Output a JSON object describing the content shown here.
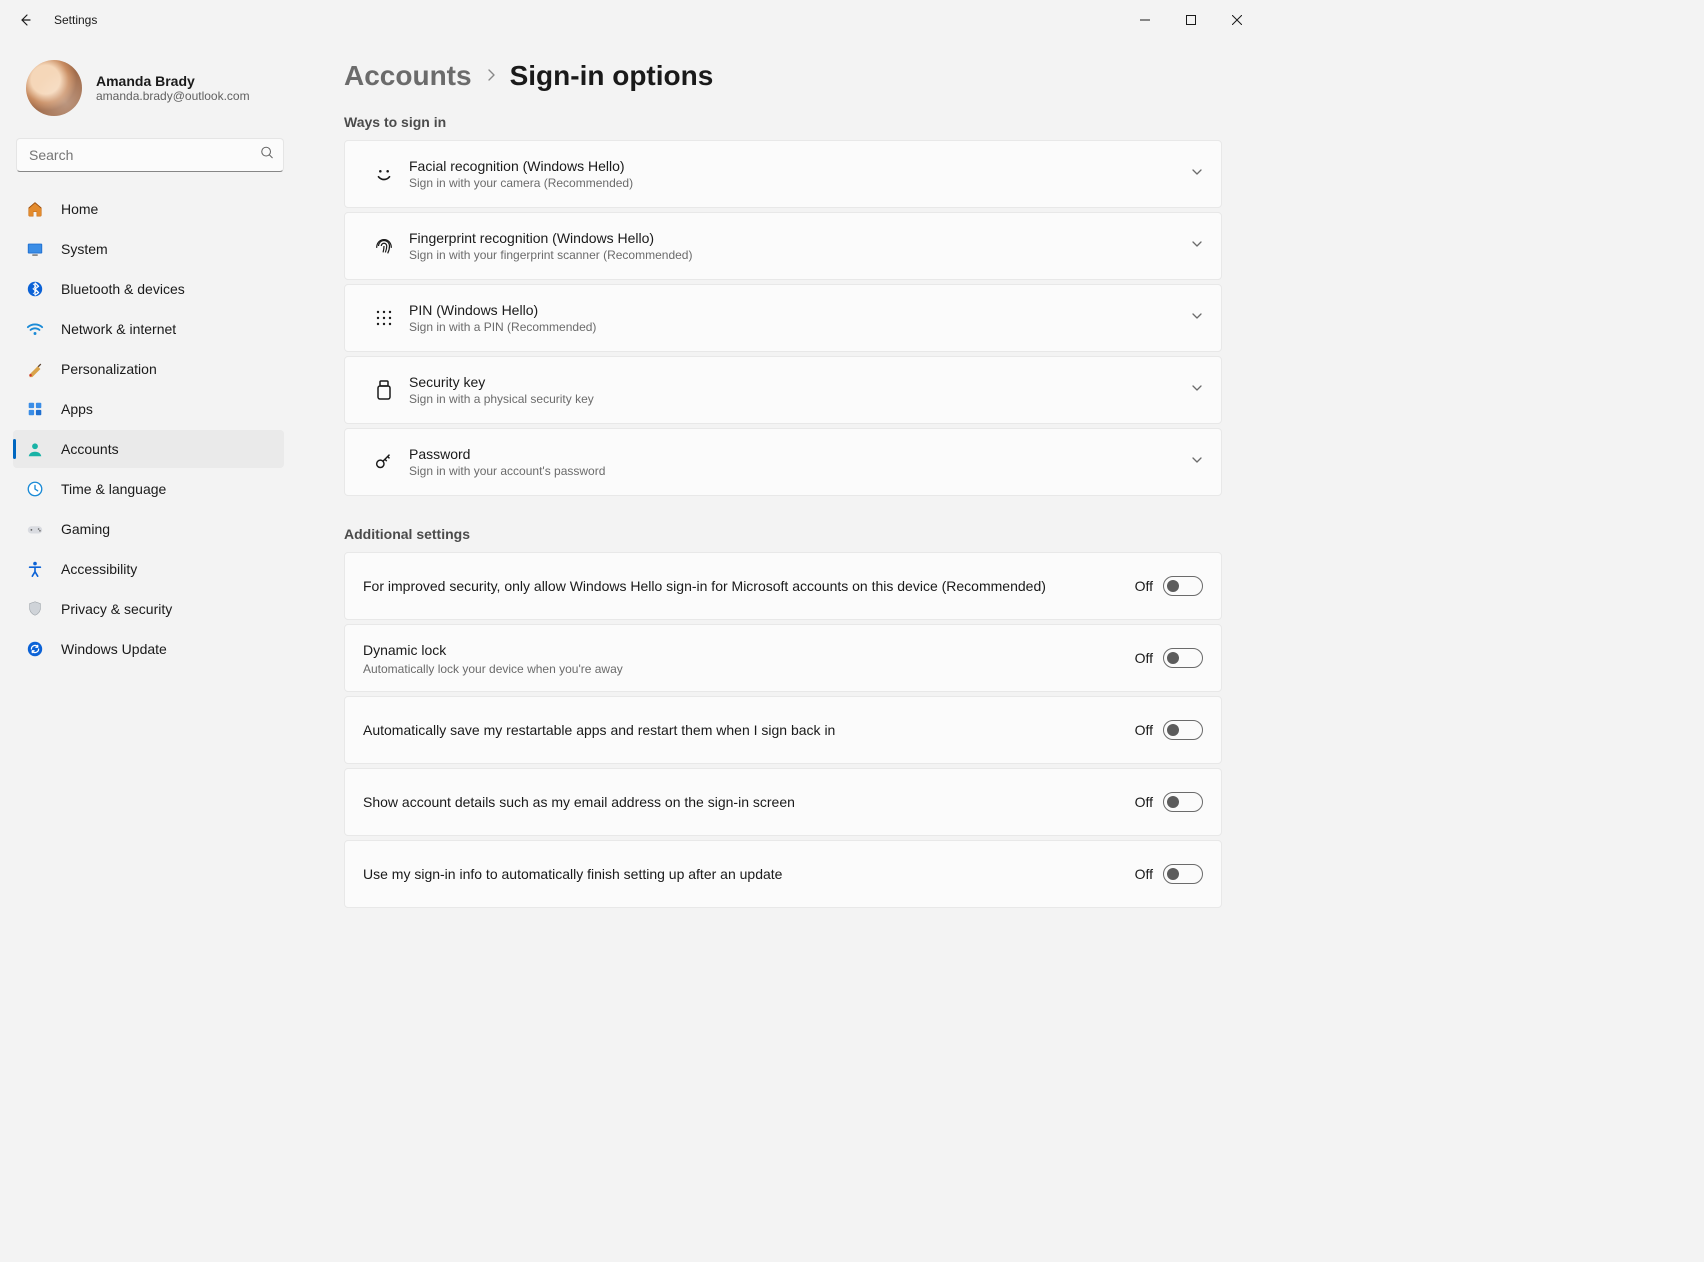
{
  "app_title": "Settings",
  "user": {
    "name": "Amanda Brady",
    "email": "amanda.brady@outlook.com"
  },
  "search": {
    "placeholder": "Search"
  },
  "nav": [
    {
      "id": "home",
      "label": "Home"
    },
    {
      "id": "system",
      "label": "System"
    },
    {
      "id": "bluetooth",
      "label": "Bluetooth & devices"
    },
    {
      "id": "network",
      "label": "Network & internet"
    },
    {
      "id": "personalization",
      "label": "Personalization"
    },
    {
      "id": "apps",
      "label": "Apps"
    },
    {
      "id": "accounts",
      "label": "Accounts",
      "active": true
    },
    {
      "id": "time",
      "label": "Time & language"
    },
    {
      "id": "gaming",
      "label": "Gaming"
    },
    {
      "id": "accessibility",
      "label": "Accessibility"
    },
    {
      "id": "privacy",
      "label": "Privacy & security"
    },
    {
      "id": "update",
      "label": "Windows Update"
    }
  ],
  "breadcrumb": {
    "parent": "Accounts",
    "current": "Sign-in options"
  },
  "sections": {
    "ways_title": "Ways to sign in",
    "additional_title": "Additional settings"
  },
  "signin_options": [
    {
      "id": "face",
      "title": "Facial recognition (Windows Hello)",
      "sub": "Sign in with your camera (Recommended)"
    },
    {
      "id": "fingerprint",
      "title": "Fingerprint recognition (Windows Hello)",
      "sub": "Sign in with your fingerprint scanner (Recommended)"
    },
    {
      "id": "pin",
      "title": "PIN (Windows Hello)",
      "sub": "Sign in with a PIN (Recommended)"
    },
    {
      "id": "securitykey",
      "title": "Security key",
      "sub": "Sign in with a physical security key"
    },
    {
      "id": "password",
      "title": "Password",
      "sub": "Sign in with your account's password"
    }
  ],
  "toggles": [
    {
      "id": "hello-only",
      "title": "For improved security, only allow Windows Hello sign-in for Microsoft accounts on this device (Recommended)",
      "sub": "",
      "state": "Off"
    },
    {
      "id": "dynamic-lock",
      "title": "Dynamic lock",
      "sub": "Automatically lock your device when you're away",
      "state": "Off"
    },
    {
      "id": "restart-apps",
      "title": "Automatically save my restartable apps and restart them when I sign back in",
      "sub": "",
      "state": "Off"
    },
    {
      "id": "show-account",
      "title": "Show account details such as my email address on the sign-in screen",
      "sub": "",
      "state": "Off"
    },
    {
      "id": "finish-setup",
      "title": "Use my sign-in info to automatically finish setting up after an update",
      "sub": "",
      "state": "Off"
    }
  ]
}
